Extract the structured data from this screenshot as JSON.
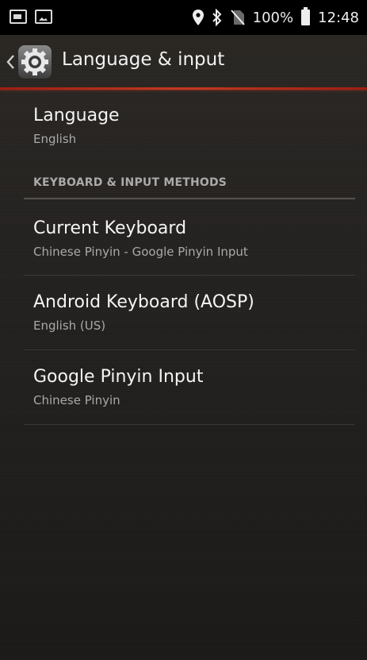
{
  "status_bar": {
    "battery": "100%",
    "time": "12:48",
    "icons": [
      "screenshot-icon",
      "image-icon",
      "location-icon",
      "bluetooth-icon",
      "no-sim-icon",
      "battery-icon"
    ]
  },
  "action_bar": {
    "title": "Language & input",
    "icon": "settings-gear-icon",
    "back_icon": "chevron-left-icon"
  },
  "settings": {
    "language": {
      "title": "Language",
      "summary": "English"
    },
    "category_keyboard": "KEYBOARD & INPUT METHODS",
    "keyboards": [
      {
        "title": "Current Keyboard",
        "summary": "Chinese Pinyin - Google Pinyin Input"
      },
      {
        "title": "Android Keyboard (AOSP)",
        "summary": "English (US)"
      },
      {
        "title": "Google Pinyin Input",
        "summary": "Chinese Pinyin"
      }
    ]
  },
  "colors": {
    "accent_divider": "#c43a22",
    "background": "#232120",
    "status_bar": "#000000"
  }
}
